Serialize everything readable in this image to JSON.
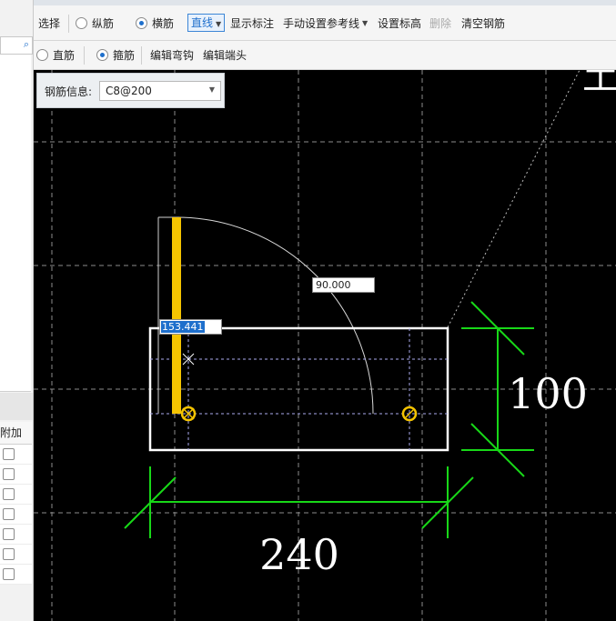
{
  "toolbar_row1": {
    "select_label": "选择",
    "radio_longitudinal_label": "纵筋",
    "radio_transverse_label": "横筋",
    "line_dropdown_label": "直线",
    "show_annotation_label": "显示标注",
    "manual_ref_line_label": "手动设置参考线",
    "set_elevation_label": "设置标高",
    "delete_label": "删除",
    "clear_rebar_label": "清空钢筋"
  },
  "toolbar_row2": {
    "radio_straight_label": "直筋",
    "radio_stirrup_label": "箍筋",
    "edit_hook_label": "编辑弯钩",
    "edit_end_label": "编辑端头"
  },
  "sidebar": {
    "search_icon": "search-icon",
    "table_header": "附加",
    "checkbox_count": 7
  },
  "rebar_info": {
    "label": "钢筋信息:",
    "value": "C8@200"
  },
  "canvas": {
    "length_input_value": "153.441",
    "angle_input_value": "90.000",
    "dim_width": "240",
    "dim_height": "100",
    "corner_glyph": "土"
  },
  "colors": {
    "rebar_highlight": "#f5c400",
    "dimension_line": "#18d818",
    "section_outline": "#ffffff",
    "grid_line": "#8c8c8c"
  }
}
